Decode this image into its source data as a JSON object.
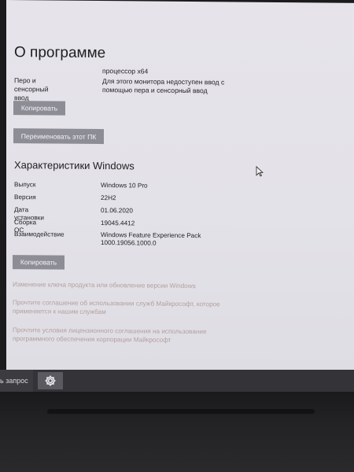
{
  "about": {
    "title": "О программе",
    "processor_value": "процессор x64",
    "pen_label": "Перо и сенсорный ввод",
    "pen_value": "Для этого монитора недоступен ввод с помощью пера и сенсорный ввод",
    "copy_button": "Копировать",
    "rename_button": "Переименовать этот ПК"
  },
  "windows_spec": {
    "title": "Характеристики Windows",
    "rows": [
      {
        "label": "Выпуск",
        "value": "Windows 10 Pro"
      },
      {
        "label": "Версия",
        "value": "22H2"
      },
      {
        "label": "Дата установки",
        "value": "01.06.2020"
      },
      {
        "label": "Сборка ОС",
        "value": "19045.4412"
      },
      {
        "label": "Взаимодействие",
        "value": "Windows Feature Experience Pack 1000.19056.1000.0"
      }
    ],
    "copy_button": "Копировать"
  },
  "links": [
    "Изменение ключа продукта или обновление версии Windows",
    "Прочтите соглашение об использовании служб Майкрософт, которое применяется к нашим службам",
    "Прочтите условия лицензионного соглашения на использование программного обеспечения корпорации Майкрософт"
  ],
  "taskbar": {
    "search_text": "ь запрос",
    "settings_icon": "gear-icon"
  },
  "colors": {
    "window_bg": "#e4e3e9",
    "button_bg": "#8d8d95",
    "link": "#a58a86",
    "taskbar": "#333338"
  }
}
